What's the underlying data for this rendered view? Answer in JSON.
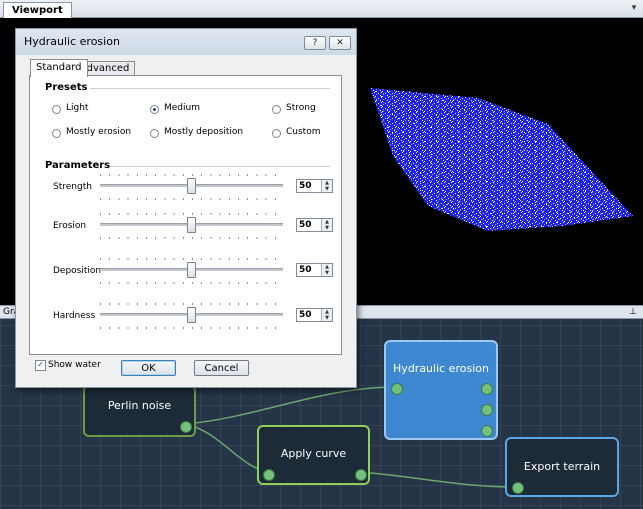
{
  "viewport": {
    "tab_label": "Viewport"
  },
  "graph": {
    "title": "Grap"
  },
  "nodes": {
    "perlin": "Perlin noise",
    "curve": "Apply curve",
    "erosion": "Hydraulic erosion",
    "export": "Export terrain"
  },
  "dialog": {
    "title": "Hydraulic erosion",
    "help": "?",
    "tabs": [
      "Standard",
      "Advanced"
    ],
    "presets": {
      "title": "Presets",
      "options": [
        "Light",
        "Medium",
        "Strong",
        "Mostly erosion",
        "Mostly deposition",
        "Custom"
      ],
      "selected": "Medium"
    },
    "parameters": {
      "title": "Parameters",
      "items": [
        {
          "label": "Strength",
          "value": "50"
        },
        {
          "label": "Erosion",
          "value": "50"
        },
        {
          "label": "Deposition",
          "value": "50"
        },
        {
          "label": "Hardness",
          "value": "50"
        }
      ]
    },
    "show_water": {
      "label": "Show water",
      "checked": true
    },
    "ok_label": "OK",
    "cancel_label": "Cancel"
  },
  "colors": {
    "terrain": "#1a1fe0",
    "accent_node": "#3e88d1",
    "graph_bg": "#253447"
  }
}
